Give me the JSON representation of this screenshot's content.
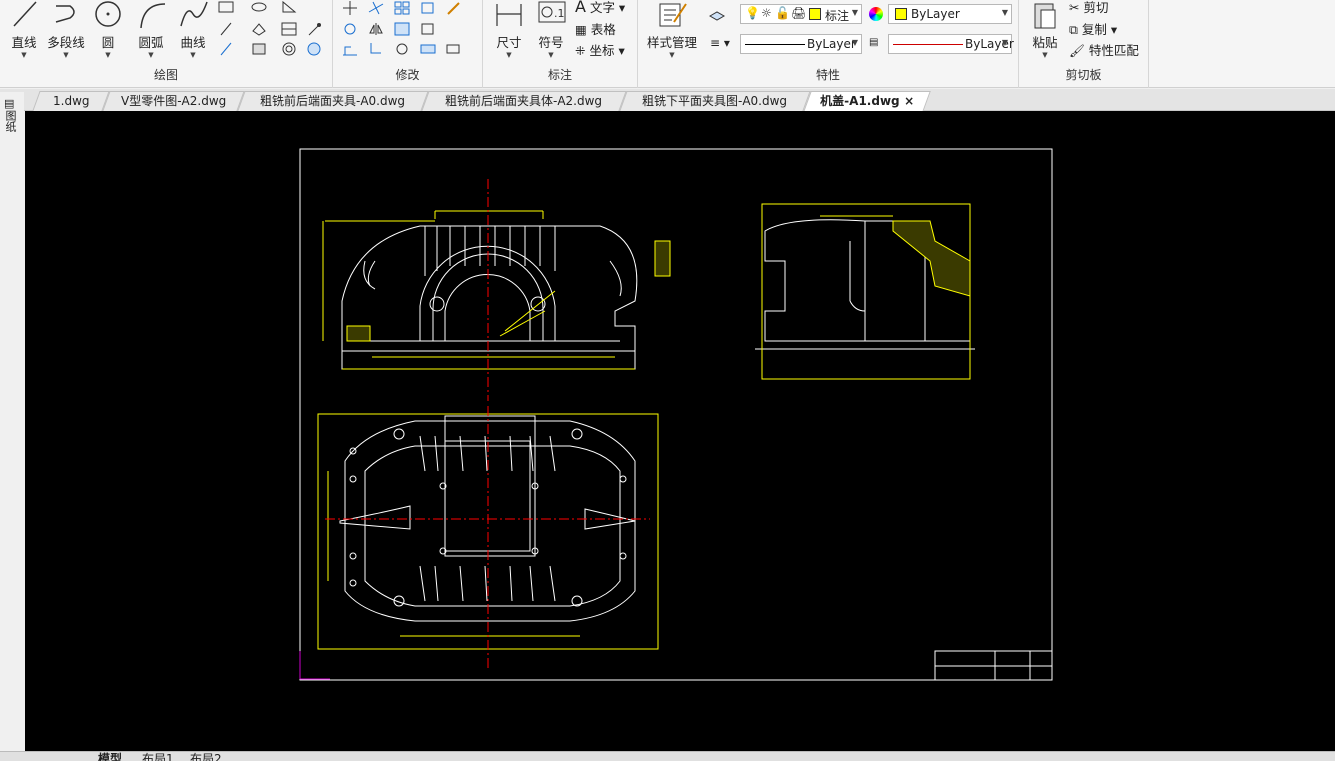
{
  "ribbon": {
    "draw": {
      "title": "绘图",
      "buttons": [
        "直线",
        "多段线",
        "圆",
        "圆弧",
        "曲线"
      ]
    },
    "modify": {
      "title": "修改"
    },
    "annotation": {
      "title": "标注",
      "buttons": [
        "尺寸",
        "符号"
      ],
      "small": [
        "文字",
        "表格",
        "坐标"
      ]
    },
    "properties": {
      "title": "特性",
      "style_button": "样式管理",
      "layer_value": "标注",
      "color_value": "ByLayer",
      "linetype_value": "ByLayer",
      "lineweight_value": "ByLayer"
    },
    "clipboard": {
      "title": "剪切板",
      "paste": "粘贴",
      "cut": "剪切",
      "copy": "复制",
      "match": "特性匹配"
    }
  },
  "tabs": [
    "1.dwg",
    "V型零件图-A2.dwg",
    "粗铣前后端面夹具-A0.dwg",
    "粗铣前后端面夹具体-A2.dwg",
    "粗铣下平面夹具图-A0.dwg",
    "机盖-A1.dwg"
  ],
  "tab_close": "×",
  "left_tool_label": "图纸",
  "layout_tabs": [
    "模型",
    "布局1",
    "布局2"
  ],
  "colors": {
    "canvas": "#000000",
    "geometry": "#ffffff",
    "dimension": "#ffff00",
    "centerline": "#ff0000",
    "ucs": "#cc00cc"
  }
}
